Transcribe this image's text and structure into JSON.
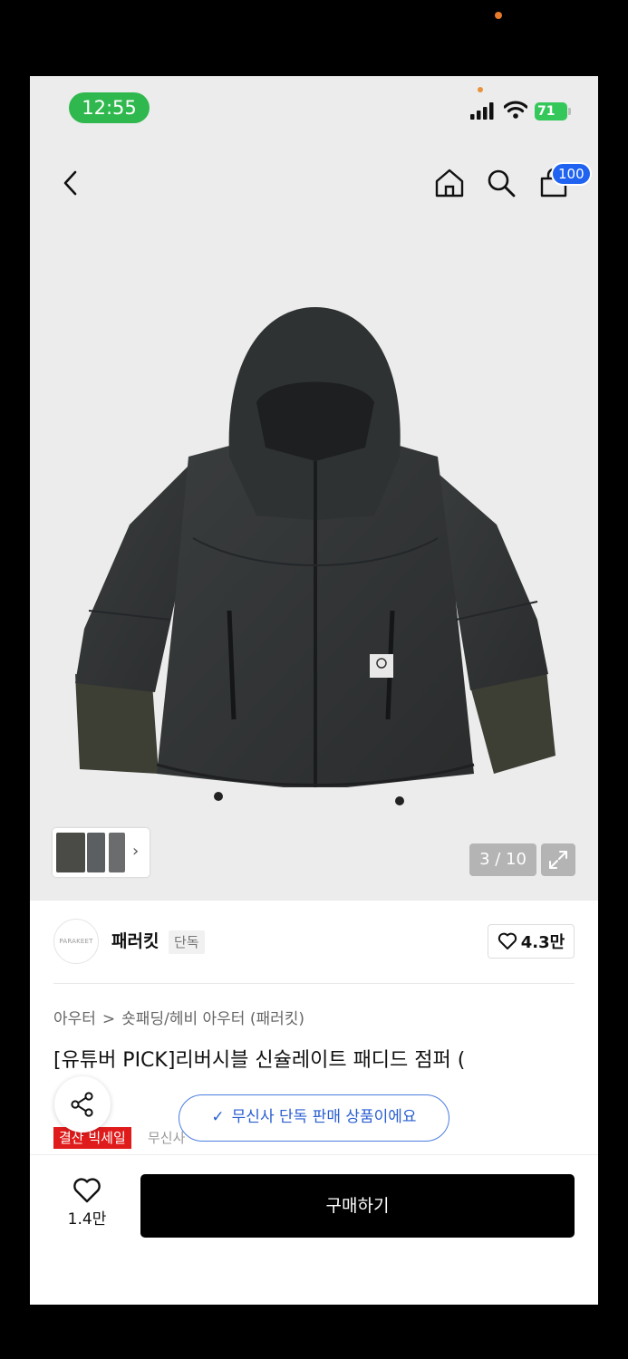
{
  "status_bar": {
    "time": "12:55",
    "battery": "71"
  },
  "cart": {
    "badge": "100"
  },
  "gallery": {
    "counter": "3 / 10"
  },
  "brand": {
    "logo_text": "PARAKEET",
    "name": "패러킷",
    "tag": "단독",
    "likes": "4.3만"
  },
  "breadcrumb": {
    "level1": "아우터",
    "separator": ">",
    "level2": "숏패딩/헤비 아우터 (패러킷)"
  },
  "product": {
    "title": "[유튜버 PICK]리버시블 신슐레이트 패디드 점퍼 ("
  },
  "toast": {
    "text": "무신사 단독 판매 상품이에요"
  },
  "promo": {
    "badge": "결산 빅세일",
    "text": "무신사"
  },
  "bottom_bar": {
    "like_count": "1.4만",
    "buy_label": "구매하기"
  },
  "colors": {
    "cart_badge": "#1f63f0",
    "time_pill": "#2fb84d",
    "sale_badge": "#e01b1b",
    "toast_accent": "#4a7de0",
    "buy_button": "#000000"
  }
}
